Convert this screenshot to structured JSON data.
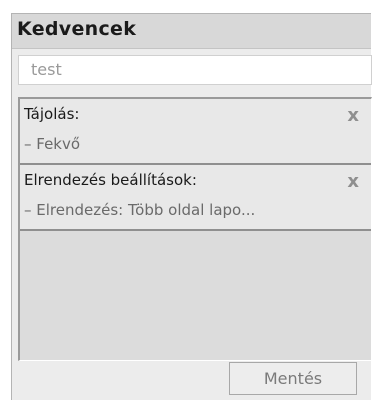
{
  "panel": {
    "title": "Kedvencek",
    "name_input": {
      "value": "test"
    },
    "items": [
      {
        "title": "Tájolás:",
        "detail": "– Fekvő"
      },
      {
        "title": "Elrendezés beállítások:",
        "detail": "– Elrendezés: Több oldal lapo..."
      }
    ],
    "save_label": "Mentés",
    "remove_glyph": "x"
  }
}
